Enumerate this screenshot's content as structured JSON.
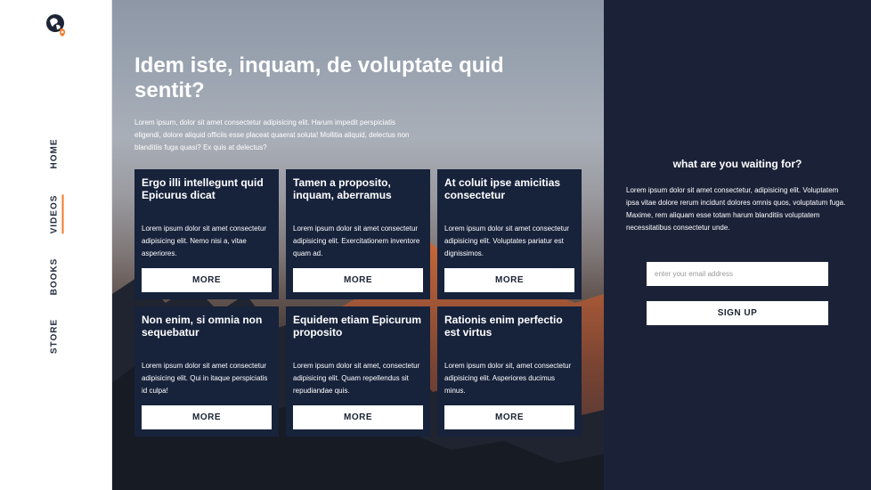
{
  "nav": {
    "logo_icon": "globe-pin-icon",
    "items": [
      {
        "label": "HOME",
        "active": false
      },
      {
        "label": "VIDEOS",
        "active": true
      },
      {
        "label": "BOOKS",
        "active": false
      },
      {
        "label": "STORE",
        "active": false
      }
    ],
    "accent_color": "#f2782a"
  },
  "hero": {
    "title": "Idem iste, inquam, de voluptate quid sentit?",
    "text": "Lorem ipsum, dolor sit amet consectetur adipisicing elit. Harum impedit perspiciatis eligendi, dolore aliquid officiis esse placeat quaerat soluta! Mollitia aliquid, delectus non blanditiis fuga quasi? Ex quis at delectus?"
  },
  "cards": [
    {
      "title": "Ergo illi intellegunt quid Epicurus dicat",
      "text": "Lorem ipsum dolor sit amet consectetur adipisicing elit. Nemo nisi a, vitae asperiores.",
      "button": "MORE"
    },
    {
      "title": "Tamen a proposito, inquam, aberramus",
      "text": "Lorem ipsum dolor sit amet consectetur adipisicing elit. Exercitationem inventore quam ad.",
      "button": "MORE"
    },
    {
      "title": "At coluit ipse amicitias consectetur",
      "text": "Lorem ipsum dolor sit amet consectetur adipisicing elit. Voluptates pariatur est dignissimos.",
      "button": "MORE"
    },
    {
      "title": "Non enim, si omnia non sequebatur",
      "text": "Lorem ipsum dolor sit amet consectetur adipisicing elit. Qui in itaque perspiciatis id culpa!",
      "button": "MORE"
    },
    {
      "title": "Equidem etiam Epicurum proposito",
      "text": "Lorem ipsum dolor sit amet, consectetur adipisicing elit. Quam repellendus sit repudiandae quis.",
      "button": "MORE"
    },
    {
      "title": "Rationis enim perfectio est virtus",
      "text": "Lorem ipsum dolor sit, amet consectetur adipisicing elit. Asperiores ducimus minus.",
      "button": "MORE"
    }
  ],
  "signup": {
    "heading": "what are you waiting for?",
    "text": "Lorem ipsum dolor sit amet consectetur, adipisicing elit. Voluptatem ipsa vitae dolore rerum incidunt dolores omnis quos, voluptatum fuga. Maxime, rem aliquam esse totam harum blanditiis voluptatem necessitatibus consectetur unde.",
    "email_placeholder": "enter your email address",
    "email_value": "",
    "button": "SIGN UP"
  },
  "colors": {
    "card_bg": "#17223b",
    "panel_bg": "#1b2238"
  }
}
